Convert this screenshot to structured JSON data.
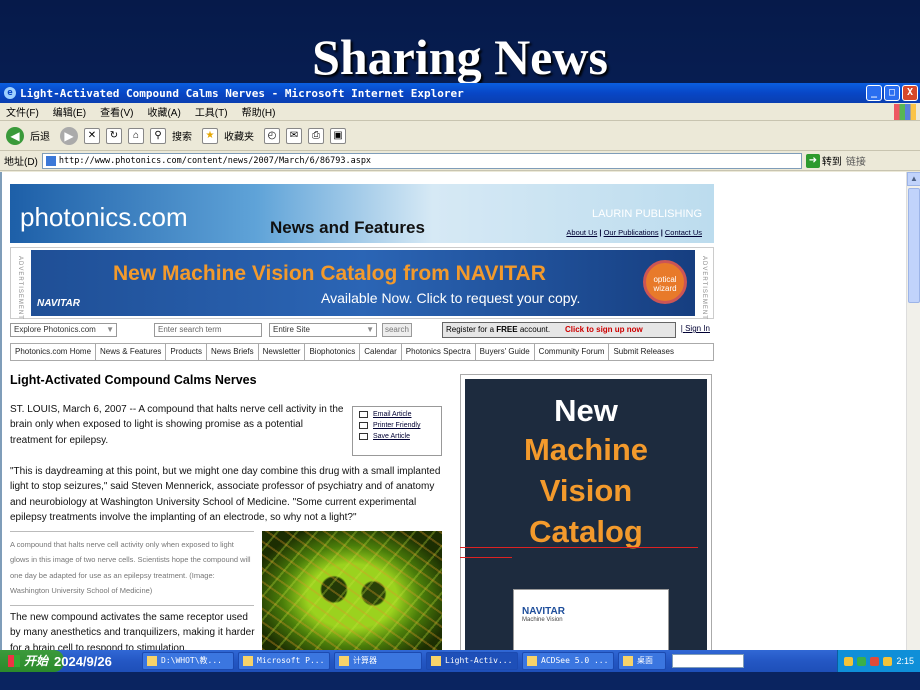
{
  "slide": {
    "title": "Sharing News"
  },
  "window": {
    "title": "Light-Activated Compound Calms Nerves - Microsoft Internet Explorer",
    "controls": {
      "minimize": "_",
      "maximize": "□",
      "close": "X"
    }
  },
  "menu": [
    "文件(F)",
    "编辑(E)",
    "查看(V)",
    "收藏(A)",
    "工具(T)",
    "帮助(H)"
  ],
  "toolbar": {
    "back": "后退",
    "search": "搜索",
    "favorites": "收藏夹"
  },
  "addressbar": {
    "label": "地址(D)",
    "url": "http://www.photonics.com/content/news/2007/March/6/86793.aspx",
    "go": "转到",
    "links": "链接"
  },
  "page": {
    "banner": {
      "logo": "photonics.com",
      "section": "News and Features",
      "publisher": "LAURIN PUBLISHING",
      "links": [
        "About Us",
        "Our Publications",
        "Contact Us"
      ],
      "separator": "|"
    },
    "ad": {
      "label": "ADVERTISEMENT",
      "headline": "New Machine Vision Catalog from NAVITAR",
      "sub": "Available Now. Click to request your copy.",
      "brand": "NAVITAR",
      "badge": "optical wizard"
    },
    "search": {
      "explore": "Explore Photonics.com",
      "placeholder": "Enter search term",
      "scope": "Entire Site",
      "button": "search",
      "register_pre": "Register for a",
      "register_free": "FREE",
      "register_post": "account.",
      "signup": "Click to sign up now",
      "signin": "Sign In",
      "signin_sep": "|"
    },
    "nav": [
      "Photonics.com Home",
      "News & Features",
      "Products",
      "News Briefs",
      "Newsletter",
      "Biophotonics",
      "Calendar",
      "Photonics Spectra",
      "Buyers' Guide",
      "Community Forum",
      "Submit Releases"
    ],
    "article": {
      "title": "Light-Activated Compound Calms Nerves",
      "p1": "ST. LOUIS, March 6, 2007 -- A compound that halts nerve cell activity in the brain only when exposed to light is showing promise as a potential treatment for epilepsy.",
      "p2": "\"This is daydreaming at this point, but we might one day combine this drug with a small implanted light to stop seizures,\" said Steven Mennerick, associate professor of psychiatry and of anatomy and neurobiology at Washington University School of Medicine. \"Some current experimental epilepsy treatments involve the implanting of an electrode, so why not a light?\"",
      "caption": "A compound that halts nerve cell activity only when exposed to light glows in this image of two nerve cells. Scientists hope the compound will one day be adapted for use as an epilepsy treatment. (Image: Washington University School of Medicine)",
      "p3": "The new compound activates the same receptor used by many anesthetics and tranquilizers, making it harder for a brain cell to respond to stimulation."
    },
    "tools": [
      "Email Article",
      "Printer Friendly",
      "Save Article"
    ],
    "side_ad": {
      "line1": "New",
      "line2": "Machine",
      "line3": "Vision",
      "line4": "Catalog",
      "book_brand": "NAVITAR",
      "book_title": "Machine Vision"
    }
  },
  "taskbar": {
    "start": "开始",
    "date": "2024/9/26",
    "tasks": [
      "D:\\WHOT\\教...",
      "Microsoft P...",
      "计算器",
      "Light-Activ...",
      "ACDSee 5.0 ...",
      "桌面"
    ],
    "time": "2:15"
  }
}
